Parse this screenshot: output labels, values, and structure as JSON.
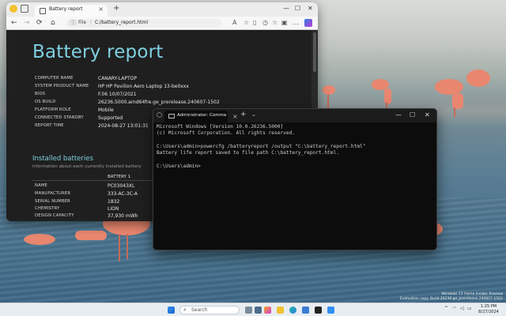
{
  "browser": {
    "tab_title": "Battery report",
    "tab_close": "×",
    "new_tab": "+",
    "min": "—",
    "max": "☐",
    "close": "✕",
    "url_label": "File",
    "url_separator": "|",
    "url": "C:/battery_report.html",
    "nav": {
      "back": "←",
      "forward": "→",
      "refresh": "⟳",
      "home": "⌂"
    }
  },
  "report": {
    "title": "Battery report",
    "rows": [
      {
        "key": "COMPUTER NAME",
        "value": "CANARY-LAPTOP"
      },
      {
        "key": "SYSTEM PRODUCT NAME",
        "value": "HP HP Pavilion Aero Laptop 13-be0xxx"
      },
      {
        "key": "BIOS",
        "value": "F.06 10/07/2021"
      },
      {
        "key": "OS BUILD",
        "value": "26236.5000.amd64fre.ge_prerelease.240607-1502"
      },
      {
        "key": "PLATFORM ROLE",
        "value": "Mobile"
      },
      {
        "key": "CONNECTED STANDBY",
        "value": "Supported"
      },
      {
        "key": "REPORT TIME",
        "value": "2024-08-27   13:01:31"
      }
    ],
    "section_title": "Installed batteries",
    "section_sub": "Information about each currently installed battery",
    "battery_column": "BATTERY 1",
    "battery_rows": [
      {
        "key": "NAME",
        "value": "PC03043XL"
      },
      {
        "key": "MANUFACTURER",
        "value": "333-AC-3C-A"
      },
      {
        "key": "SERIAL NUMBER",
        "value": "1832"
      },
      {
        "key": "CHEMISTRY",
        "value": "LION"
      },
      {
        "key": "DESIGN CAPACITY",
        "value": "37,930 mWh"
      }
    ]
  },
  "terminal": {
    "tab_title": "Administrator: Command Pro",
    "tab_close": "×",
    "new_tab": "+",
    "dropdown": "⌄",
    "min": "—",
    "max": "☐",
    "close": "✕",
    "lines": [
      "Microsoft Windows [Version 10.0.26236.5000]",
      "(c) Microsoft Corporation. All rights reserved.",
      "",
      "C:\\Users\\admin>powercfg /batteryreport /output \"C:\\battery_report.html\"",
      "Battery life report saved to file path C:\\battery_report.html.",
      "",
      "C:\\Users\\admin>"
    ]
  },
  "taskbar": {
    "search_placeholder": "Search",
    "time": "1:25 PM",
    "date": "8/27/2024",
    "tray_chevron": "^"
  },
  "watermark": {
    "line1": "Windows 11 Home Insider Preview",
    "line2": "Evaluation copy. Build 26236.ge_prerelease.240607-1502"
  },
  "colors": {
    "report_accent": "#7fd0e2",
    "terminal_bg": "#0c0c0c",
    "taskbar_bg": "#e8edf2"
  }
}
